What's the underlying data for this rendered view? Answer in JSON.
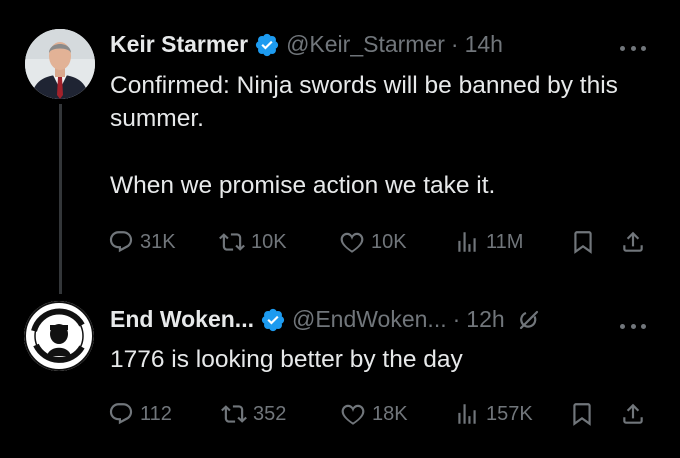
{
  "colors": {
    "background": "#000000",
    "text": "#e7e9ea",
    "secondary": "#71767b",
    "verified": "#1d9bf0",
    "thread_line": "#333639"
  },
  "tweets": [
    {
      "name": "Keir Starmer",
      "handle": "@Keir_Starmer",
      "separator": "·",
      "time": "14h",
      "paragraphs": [
        "Confirmed: Ninja swords will be banned by this summer.",
        "When we promise action we take it."
      ],
      "icons": [
        "verified-badge-icon",
        "more-options-icon"
      ],
      "actions": {
        "replies": "31K",
        "reposts": "10K",
        "likes": "10K",
        "views": "11M"
      }
    },
    {
      "name": "End Woken...",
      "handle": "@EndWoken...",
      "separator": "·",
      "time": "12h",
      "paragraphs": [
        "1776 is looking better by the day"
      ],
      "avatar_text": "I SUPPORT THE FARMER THINGS",
      "icons": [
        "verified-badge-icon",
        "grok-icon",
        "more-options-icon"
      ],
      "actions": {
        "replies": "112",
        "reposts": "352",
        "likes": "18K",
        "views": "157K"
      }
    }
  ]
}
